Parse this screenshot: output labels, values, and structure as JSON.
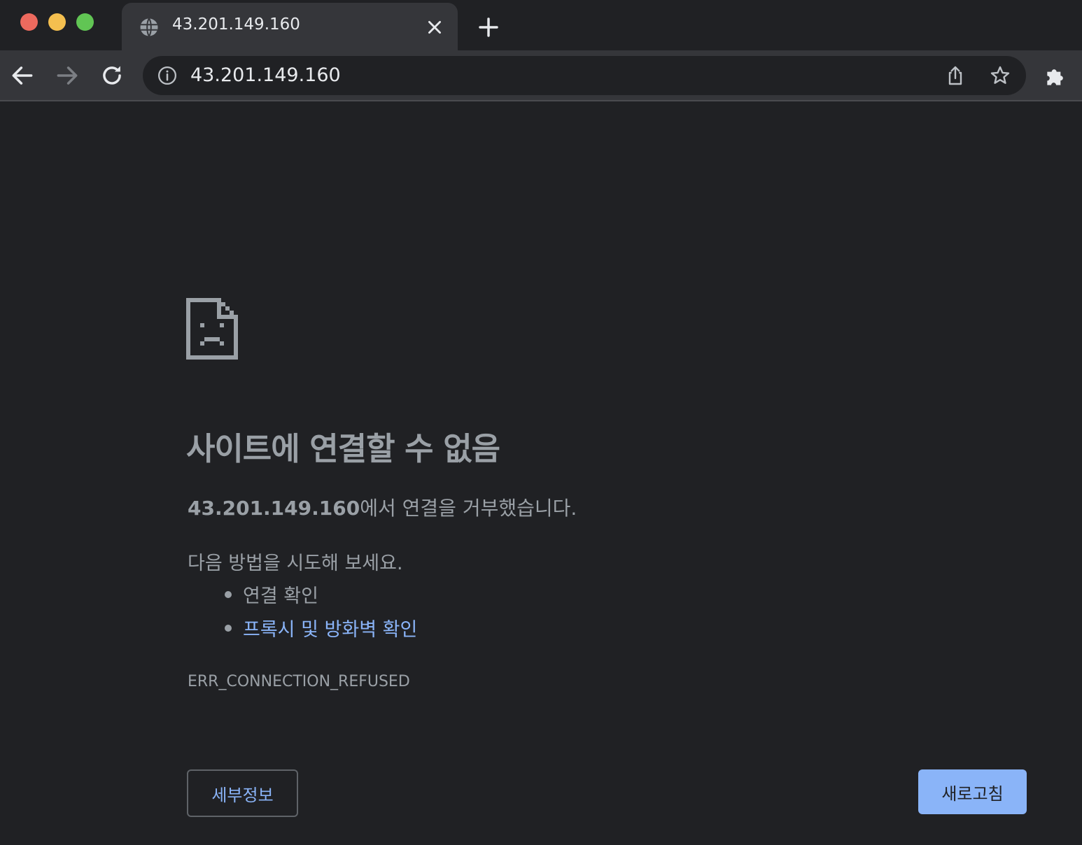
{
  "window": {
    "controls": [
      "close",
      "minimize",
      "maximize"
    ]
  },
  "tab": {
    "title": "43.201.149.160",
    "favicon": "globe-icon",
    "close_icon": "close-icon"
  },
  "new_tab_icon": "plus-icon",
  "toolbar": {
    "back_icon": "arrow-left-icon",
    "forward_icon": "arrow-right-icon",
    "reload_icon": "reload-icon",
    "site_info_icon": "info-icon",
    "url": "43.201.149.160",
    "share_icon": "share-icon",
    "bookmark_icon": "star-icon",
    "extensions_icon": "puzzle-icon"
  },
  "error": {
    "icon": "sad-page-icon",
    "title": "사이트에 연결할 수 없음",
    "host": "43.201.149.160",
    "summary_suffix": "에서 연결을 거부했습니다.",
    "suggestions_heading": "다음 방법을 시도해 보세요.",
    "suggestions": [
      {
        "label": "연결 확인",
        "is_link": false
      },
      {
        "label": "프록시 및 방화벽 확인",
        "is_link": true
      }
    ],
    "code": "ERR_CONNECTION_REFUSED"
  },
  "buttons": {
    "details_label": "세부정보",
    "reload_label": "새로고침"
  },
  "colors": {
    "background": "#202124",
    "toolbar": "#35363a",
    "text_muted": "#9aa0a6",
    "link": "#8ab4f8",
    "primary_button": "#8ab4f8"
  }
}
